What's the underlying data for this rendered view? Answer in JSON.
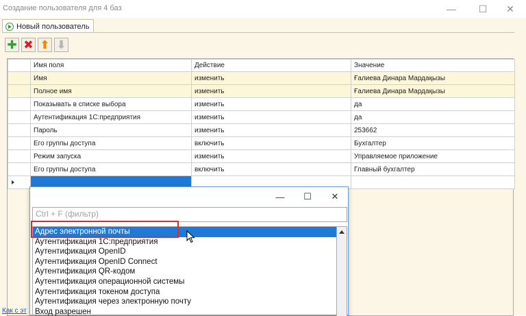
{
  "window": {
    "title": "Создание пользователя для 4 баз",
    "minimize_glyph": "—",
    "maximize_glyph": "☐",
    "close_glyph": "✕"
  },
  "tab": {
    "label": "Новый пользователь",
    "icon": "play-circle-icon"
  },
  "toolbar": {
    "add": {
      "glyph": "✚",
      "color": "#2ea02e"
    },
    "delete": {
      "glyph": "✖",
      "color": "#d42020"
    },
    "up": {
      "glyph": "⬆",
      "color": "#f08a00"
    },
    "down": {
      "glyph": "⬇",
      "color": "#b5b5b5"
    }
  },
  "grid": {
    "columns": [
      "Имя поля",
      "Действие",
      "Значение"
    ],
    "rows": [
      {
        "field": "Имя",
        "action": "изменить",
        "value": "Ғалиева Динара Мардақызы",
        "highlight": true
      },
      {
        "field": "Полное имя",
        "action": "изменить",
        "value": "Ғалиева Динара Мардақызы",
        "highlight": true
      },
      {
        "field": "Показывать в списке выбора",
        "action": "изменить",
        "value": "да",
        "highlight": false
      },
      {
        "field": "Аутентификация 1С:предприятия",
        "action": "изменить",
        "value": "да",
        "highlight": false
      },
      {
        "field": "Пароль",
        "action": "изменить",
        "value": "253662",
        "highlight": false
      },
      {
        "field": "Его группы доступа",
        "action": "включить",
        "value": "Бухгалтер",
        "highlight": false
      },
      {
        "field": "Режим запуска",
        "action": "изменить",
        "value": "Управляемое приложение",
        "highlight": false
      },
      {
        "field": "Его группы доступа",
        "action": "включить",
        "value": "Главный бухгалтер",
        "highlight": false
      }
    ]
  },
  "popup": {
    "minimize_glyph": "—",
    "maximize_glyph": "☐",
    "close_glyph": "✕",
    "filter_placeholder": "Ctrl + F (фильтр)",
    "items": [
      "Адрес электронной почты",
      "Аутентификация 1С:предприятия",
      "Аутентификация OpenID",
      "Аутентификация OpenID Connect",
      "Аутентификация QR-кодом",
      "Аутентификация операционной системы",
      "Аутентификация токеном доступа",
      "Аутентификация через электронную почту",
      "Вход разрешен"
    ],
    "selected_index": 0
  },
  "footer": {
    "help_link": "Как с эт"
  },
  "colors": {
    "accent": "#1e7ad6",
    "row_highlight": "#fcf7d8",
    "annotation": "#d92b2b"
  }
}
